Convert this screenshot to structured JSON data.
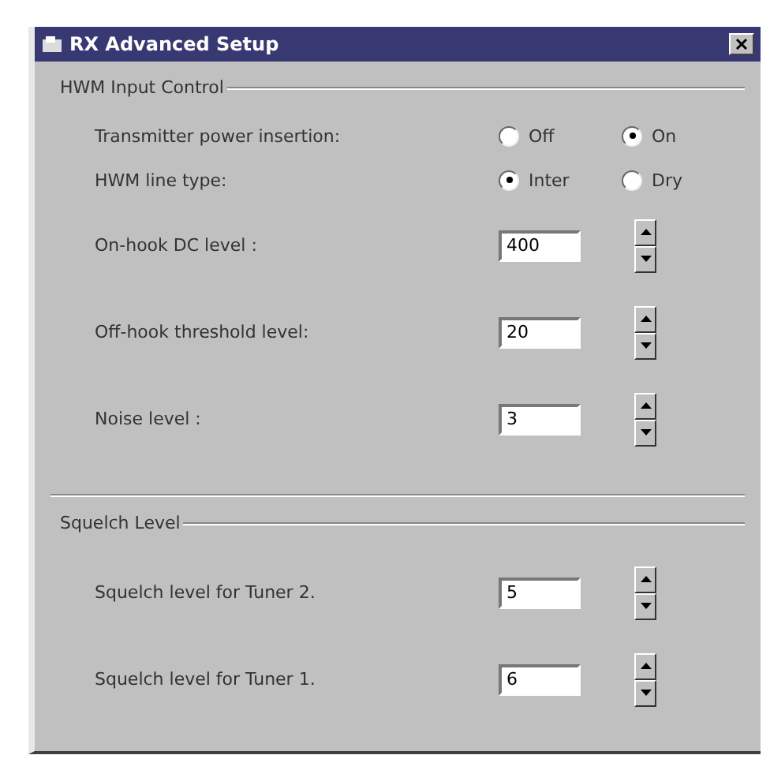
{
  "window": {
    "title": "RX Advanced Setup"
  },
  "groups": [
    {
      "title": "HWM Input Control",
      "rows": [
        {
          "kind": "radio",
          "label": "Transmitter power insertion:",
          "options": [
            {
              "label": "Off",
              "selected": false
            },
            {
              "label": "On",
              "selected": true
            }
          ]
        },
        {
          "kind": "radio",
          "label": "HWM line type:",
          "options": [
            {
              "label": "Inter",
              "selected": true
            },
            {
              "label": "Dry",
              "selected": false
            }
          ]
        },
        {
          "kind": "spin",
          "label": "On-hook DC level :",
          "value": "400"
        },
        {
          "kind": "spin",
          "label": "Off-hook threshold level:",
          "value": "20"
        },
        {
          "kind": "spin",
          "label": "Noise level :",
          "value": "3"
        }
      ]
    },
    {
      "title": "Squelch Level",
      "rows": [
        {
          "kind": "spin",
          "label": "Squelch level for Tuner 2.",
          "value": "5"
        },
        {
          "kind": "spin",
          "label": "Squelch level for Tuner 1.",
          "value": "6"
        }
      ]
    }
  ]
}
